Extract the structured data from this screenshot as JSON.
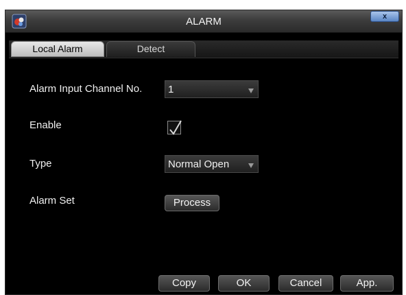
{
  "window": {
    "title": "ALARM",
    "close_label": "x"
  },
  "tabs": [
    {
      "label": "Local Alarm",
      "active": true
    },
    {
      "label": "Detect",
      "active": false
    }
  ],
  "form": {
    "channel_label": "Alarm Input Channel No.",
    "channel_value": "1",
    "enable_label": "Enable",
    "enable_checked": true,
    "type_label": "Type",
    "type_value": "Normal Open",
    "alarm_set_label": "Alarm Set",
    "process_label": "Process"
  },
  "footer": {
    "copy_label": "Copy",
    "ok_label": "OK",
    "cancel_label": "Cancel",
    "apply_label": "App."
  },
  "colors": {
    "background": "#000000",
    "text": "#f0f0f0",
    "close_button": "#5a86c4"
  }
}
